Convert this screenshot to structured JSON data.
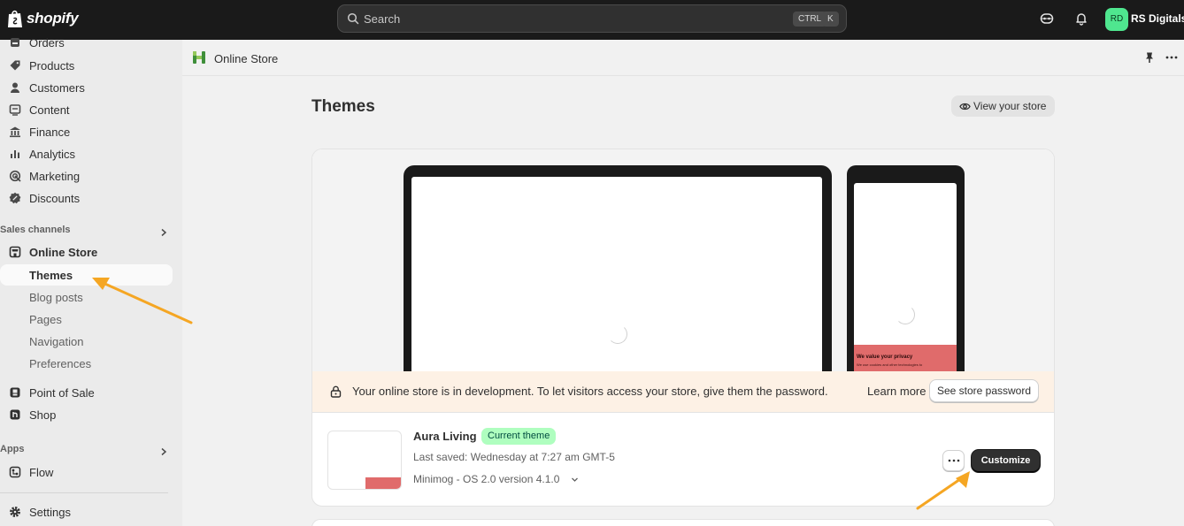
{
  "topbar": {
    "logo_text": "shopify",
    "search_placeholder": "Search",
    "shortcut_ctrl": "CTRL",
    "shortcut_k": "K",
    "avatar_initials": "RD",
    "store_name": "RS Digitals"
  },
  "sidebar": {
    "items": [
      {
        "label": "Orders",
        "icon": "orders-icon"
      },
      {
        "label": "Products",
        "icon": "tag-icon"
      },
      {
        "label": "Customers",
        "icon": "person-icon"
      },
      {
        "label": "Content",
        "icon": "content-icon"
      },
      {
        "label": "Finance",
        "icon": "bank-icon"
      },
      {
        "label": "Analytics",
        "icon": "bar-chart-icon"
      },
      {
        "label": "Marketing",
        "icon": "target-icon"
      },
      {
        "label": "Discounts",
        "icon": "discount-icon"
      }
    ],
    "sales_channels_heading": "Sales channels",
    "online_store": "Online Store",
    "sub_items": [
      "Themes",
      "Blog posts",
      "Pages",
      "Navigation",
      "Preferences"
    ],
    "pos": "Point of Sale",
    "shop": "Shop",
    "apps_heading": "Apps",
    "flow": "Flow",
    "settings": "Settings"
  },
  "breadcrumb": {
    "title": "Online Store"
  },
  "main": {
    "page_title": "Themes",
    "view_store_label": "View your store",
    "preview": {
      "privacy_title": "We value your privacy",
      "privacy_sub": "We use cookies and other technologies to"
    },
    "banner": {
      "text": "Your online store is in development. To let visitors access your store, give them the password.",
      "learn_more": "Learn more",
      "see_password": "See store password"
    },
    "theme": {
      "name": "Aura Living",
      "badge": "Current theme",
      "last_saved": "Last saved: Wednesday at 7:27 am GMT-5",
      "version": "Minimog - OS 2.0 version 4.1.0",
      "customize_label": "Customize"
    }
  },
  "colors": {
    "topbar": "#1a1a1a",
    "badge_bg": "#affebf",
    "banner_bg": "#fdf1e5",
    "arrow": "#f5a623",
    "privacy_red": "#e06b6b"
  }
}
